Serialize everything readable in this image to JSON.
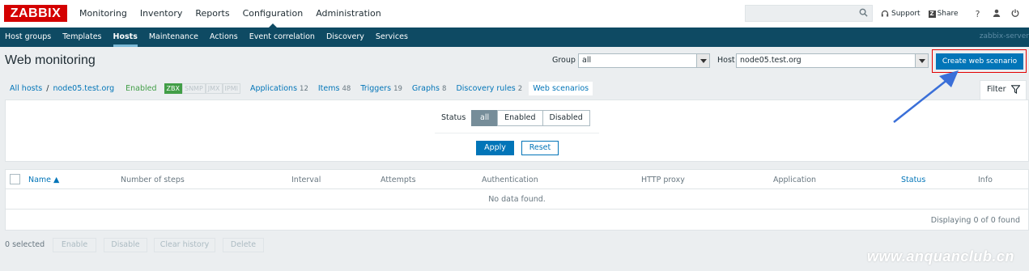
{
  "logo": {
    "text": "ZABBIX"
  },
  "top_nav": [
    {
      "label": "Monitoring"
    },
    {
      "label": "Inventory"
    },
    {
      "label": "Reports"
    },
    {
      "label": "Configuration"
    },
    {
      "label": "Administration"
    }
  ],
  "top_links": {
    "support": "Support",
    "share": "Share",
    "share_badge": "Z",
    "help": "?"
  },
  "sub_nav": [
    {
      "label": "Host groups"
    },
    {
      "label": "Templates"
    },
    {
      "label": "Hosts"
    },
    {
      "label": "Maintenance"
    },
    {
      "label": "Actions"
    },
    {
      "label": "Event correlation"
    },
    {
      "label": "Discovery"
    },
    {
      "label": "Services"
    }
  ],
  "server_name": "zabbix-server",
  "page": {
    "title": "Web monitoring",
    "group_label": "Group",
    "group_value": "all",
    "host_label": "Host",
    "host_value": "node05.test.org",
    "create_button": "Create web scenario"
  },
  "breadcrumb": {
    "all_hosts": "All hosts",
    "separator": "/",
    "host": "node05.test.org",
    "status": "Enabled",
    "availability": [
      "ZBX",
      "SNMP",
      "JMX",
      "IPMI"
    ],
    "tabs": [
      {
        "label": "Applications",
        "count": "12"
      },
      {
        "label": "Items",
        "count": "48"
      },
      {
        "label": "Triggers",
        "count": "19"
      },
      {
        "label": "Graphs",
        "count": "8"
      },
      {
        "label": "Discovery rules",
        "count": "2"
      },
      {
        "label": "Web scenarios",
        "count": ""
      }
    ]
  },
  "filter": {
    "tab_label": "Filter",
    "status_label": "Status",
    "options": [
      "all",
      "Enabled",
      "Disabled"
    ],
    "selected": "all",
    "apply": "Apply",
    "reset": "Reset"
  },
  "table": {
    "columns": [
      "Name ▲",
      "Number of steps",
      "Interval",
      "Attempts",
      "Authentication",
      "HTTP proxy",
      "Application",
      "Status",
      "Info"
    ],
    "no_data": "No data found.",
    "footer": "Displaying 0 of 0 found"
  },
  "bottom": {
    "selected": "0 selected",
    "buttons": [
      "Enable",
      "Disable",
      "Clear history",
      "Delete"
    ]
  },
  "watermark": "www.anquanclub.cn",
  "colors": {
    "brand": "#d40000",
    "nav": "#0e4a63",
    "primary": "#0275b8",
    "enabled": "#429e47",
    "highlight": "#e30000"
  }
}
